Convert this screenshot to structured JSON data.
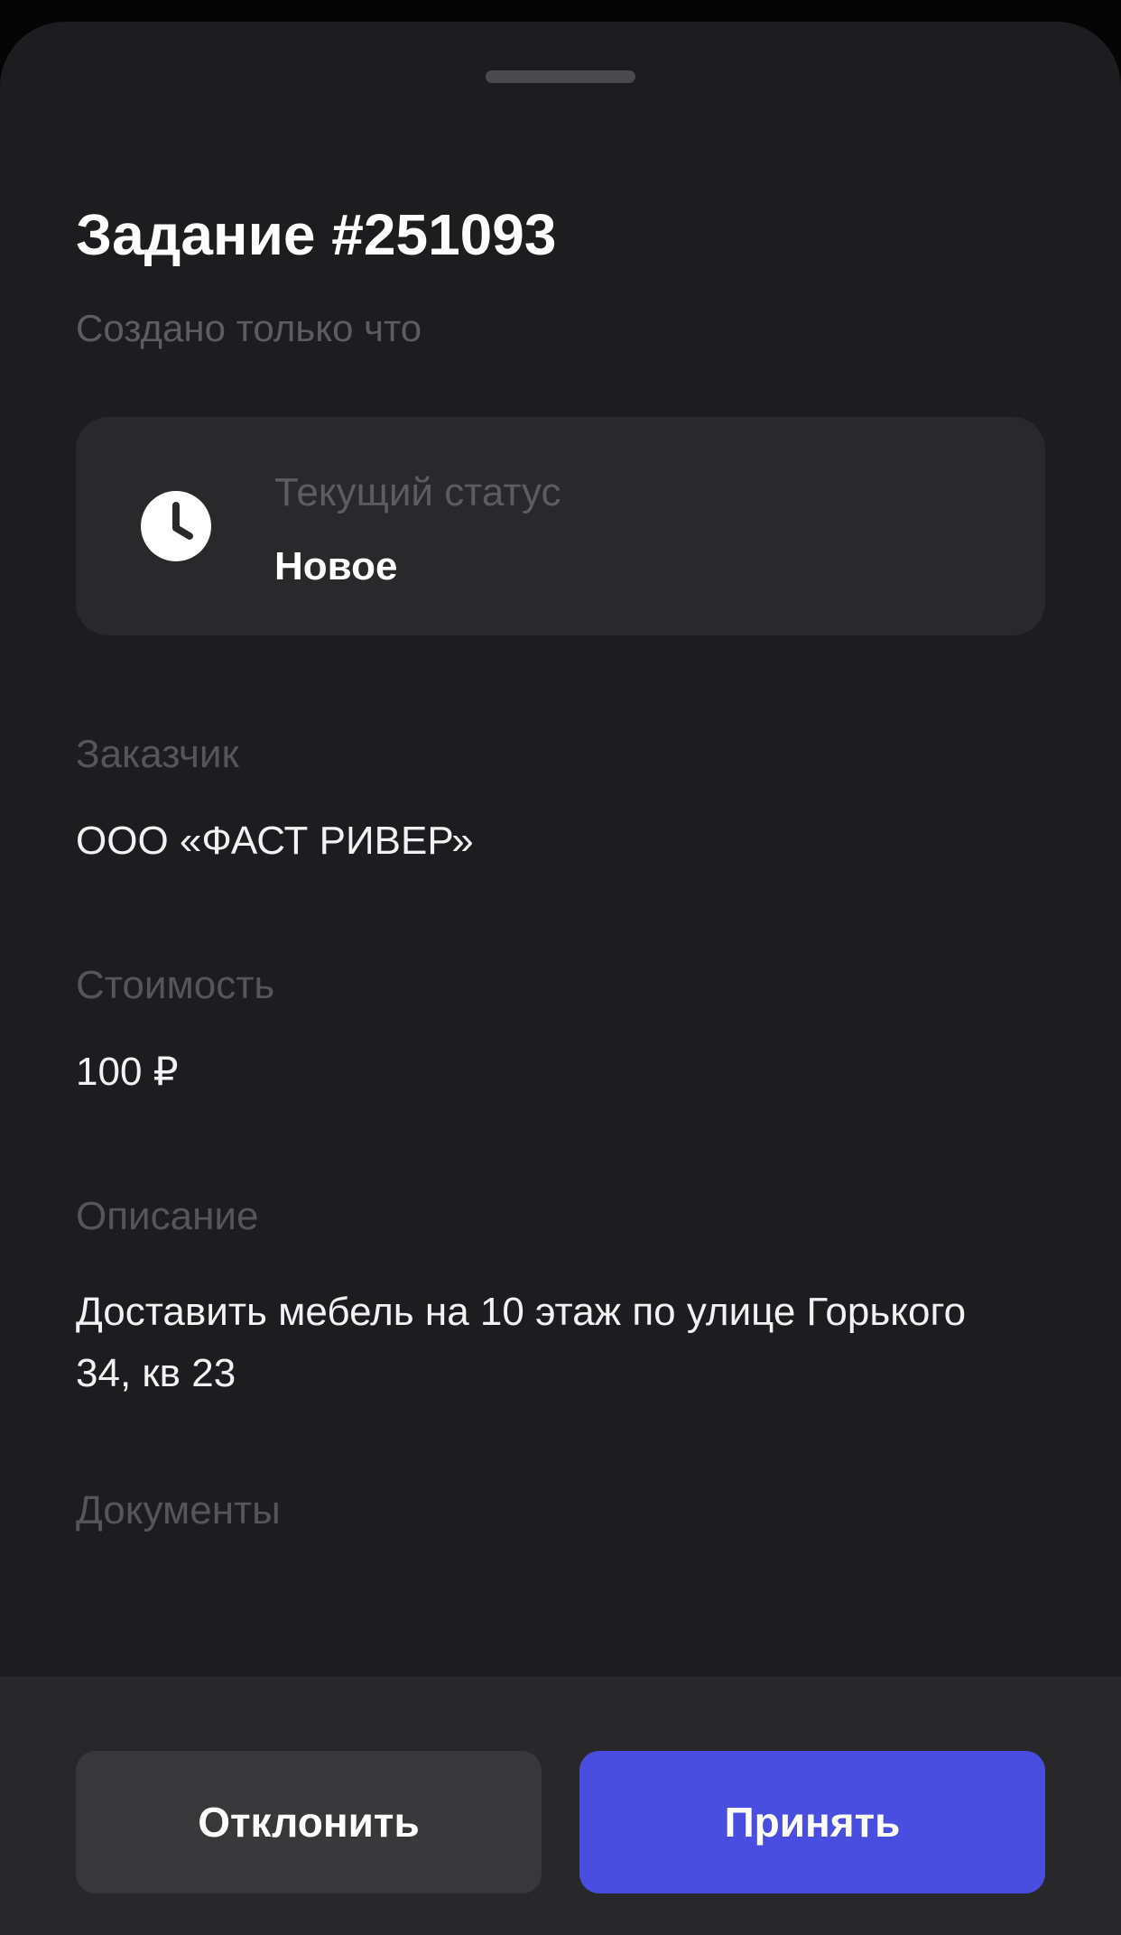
{
  "task": {
    "title": "Задание #251093",
    "created": "Создано только что"
  },
  "status": {
    "label": "Текущий статус",
    "value": "Новое",
    "icon": "clock-icon"
  },
  "customer": {
    "label": "Заказчик",
    "value": "ООО «ФАСТ РИВЕР»"
  },
  "price": {
    "label": "Стоимость",
    "value": "100 ₽"
  },
  "description": {
    "label": "Описание",
    "value": "Доставить мебель на 10 этаж по улице Горького 34, кв 23"
  },
  "documents": {
    "label": "Документы"
  },
  "actions": {
    "decline_label": "Отклонить",
    "accept_label": "Принять"
  },
  "colors": {
    "accent": "#4a4ee0",
    "sheet_background": "#1d1d1f",
    "card_background": "#29292c",
    "muted_text": "#5c5c61"
  }
}
